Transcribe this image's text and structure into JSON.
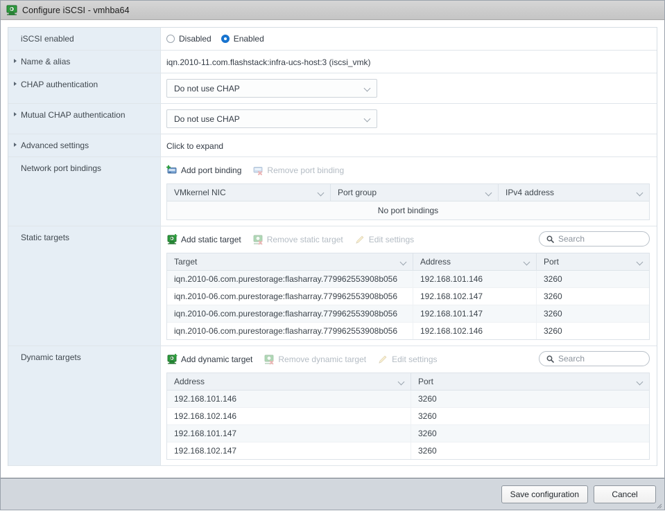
{
  "window": {
    "title": "Configure iSCSI - vmhba64",
    "icon": "iscsi-adapter-icon"
  },
  "form": {
    "iscsi_enabled": {
      "label": "iSCSI enabled",
      "options": [
        {
          "label": "Disabled",
          "selected": false
        },
        {
          "label": "Enabled",
          "selected": true
        }
      ]
    },
    "name_alias": {
      "label": "Name & alias",
      "value": "iqn.2010-11.com.flashstack:infra-ucs-host:3 (iscsi_vmk)"
    },
    "chap": {
      "label": "CHAP authentication",
      "value": "Do not use CHAP"
    },
    "mutual_chap": {
      "label": "Mutual CHAP authentication",
      "value": "Do not use CHAP"
    },
    "advanced": {
      "label": "Advanced settings",
      "value": "Click to expand"
    },
    "port_bindings": {
      "label": "Network port bindings",
      "toolbar": {
        "add": "Add port binding",
        "remove": "Remove port binding"
      },
      "columns": [
        "VMkernel NIC",
        "Port group",
        "IPv4 address"
      ],
      "empty_text": "No port bindings",
      "rows": []
    },
    "static_targets": {
      "label": "Static targets",
      "toolbar": {
        "add": "Add static target",
        "remove": "Remove static target",
        "edit": "Edit settings"
      },
      "search_placeholder": "Search",
      "columns": [
        "Target",
        "Address",
        "Port"
      ],
      "rows": [
        {
          "target": "iqn.2010-06.com.purestorage:flasharray.779962553908b056",
          "address": "192.168.101.146",
          "port": "3260"
        },
        {
          "target": "iqn.2010-06.com.purestorage:flasharray.779962553908b056",
          "address": "192.168.102.147",
          "port": "3260"
        },
        {
          "target": "iqn.2010-06.com.purestorage:flasharray.779962553908b056",
          "address": "192.168.101.147",
          "port": "3260"
        },
        {
          "target": "iqn.2010-06.com.purestorage:flasharray.779962553908b056",
          "address": "192.168.102.146",
          "port": "3260"
        }
      ]
    },
    "dynamic_targets": {
      "label": "Dynamic targets",
      "toolbar": {
        "add": "Add dynamic target",
        "remove": "Remove dynamic target",
        "edit": "Edit settings"
      },
      "search_placeholder": "Search",
      "columns": [
        "Address",
        "Port"
      ],
      "rows": [
        {
          "address": "192.168.101.146",
          "port": "3260"
        },
        {
          "address": "192.168.102.146",
          "port": "3260"
        },
        {
          "address": "192.168.101.147",
          "port": "3260"
        },
        {
          "address": "192.168.102.147",
          "port": "3260"
        }
      ]
    }
  },
  "footer": {
    "save_label": "Save configuration",
    "cancel_label": "Cancel"
  },
  "colors": {
    "label_bg": "#e6eef5",
    "accent_blue": "#1675d1",
    "titlebar": "#cbcbcb",
    "footer": "#d2d7dd"
  }
}
